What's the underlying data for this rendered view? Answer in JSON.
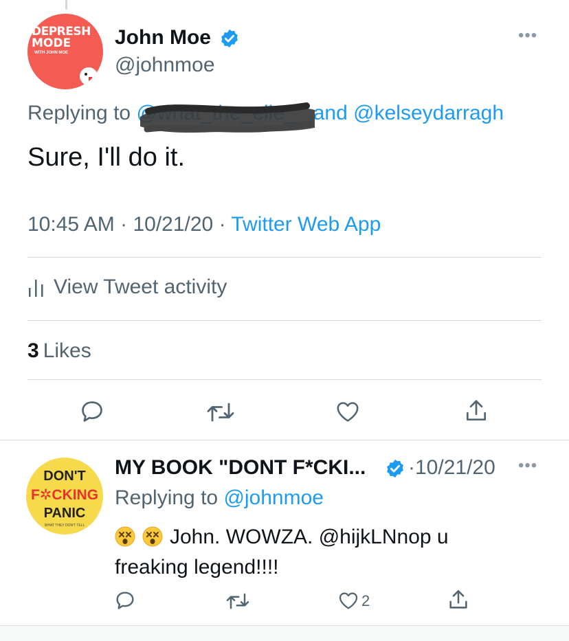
{
  "main_tweet": {
    "avatar_text": {
      "line1": "DEPRESH",
      "line2": "MODE",
      "line3": "WITH JOHN MOE"
    },
    "author_name": "John Moe",
    "handle": "@johnmoe",
    "more_label": "•••",
    "replying_prefix": "Replying to",
    "replying_first": "@what_the_elle__",
    "replying_and": "and",
    "replying_second": "@kelseydarragh",
    "text": "Sure, I'll do it.",
    "time": "10:45 AM",
    "date": "10/21/20",
    "separator": "·",
    "source": "Twitter Web App",
    "activity_label": "View Tweet activity",
    "likes_count": "3",
    "likes_label": "Likes"
  },
  "reply_tweet": {
    "avatar_text": {
      "line1": "DON'T",
      "line2": "F✲CKING",
      "line3": "PANIC",
      "line4": "WHAT THEY DON'T TELL"
    },
    "author_name": "MY BOOK \"DONT F*CKI...",
    "separator": "·",
    "date": "10/21/20",
    "more_label": "•••",
    "replying_prefix": "Replying to",
    "replying_to": "@johnmoe",
    "text": "John. WOWZA. @hijkLNnop u freaking legend!!!!",
    "emoji_name": "dizzy-face-emoji",
    "like_count": "2"
  },
  "colors": {
    "accent": "#1d9bf0",
    "secondary_text": "#536471",
    "primary_text": "#0f1419",
    "divider": "#cfd9de",
    "main_avatar_bg": "#f45b52",
    "reply_avatar_bg": "#f7d94c"
  },
  "icons": [
    "verified-badge-icon",
    "reply-icon",
    "retweet-icon",
    "like-icon",
    "share-icon",
    "activity-icon",
    "more-icon"
  ]
}
